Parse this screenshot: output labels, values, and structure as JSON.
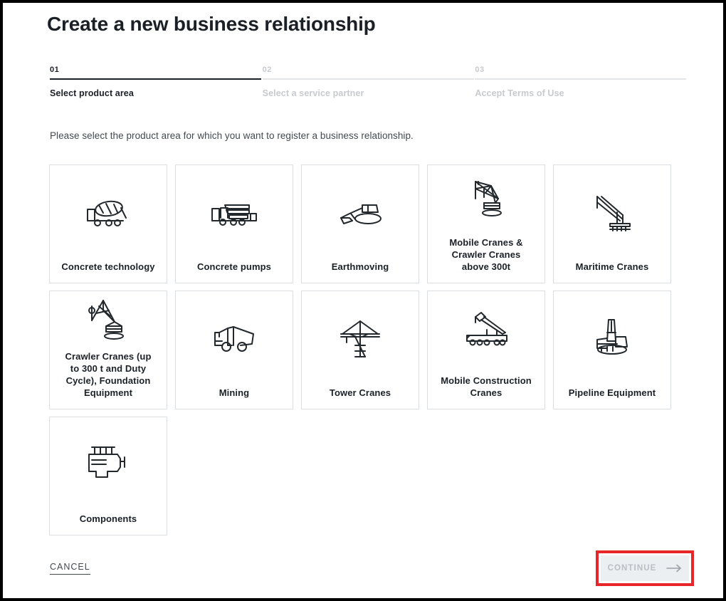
{
  "page": {
    "title": "Create a new business relationship",
    "intro": "Please select the product area for which you want to register a business relationship."
  },
  "stepper": {
    "steps": [
      {
        "number": "01",
        "label": "Select product area",
        "state": "active"
      },
      {
        "number": "02",
        "label": "Select a service partner",
        "state": "inactive"
      },
      {
        "number": "03",
        "label": "Accept Terms of Use",
        "state": "inactive"
      }
    ]
  },
  "product_areas": {
    "cards": [
      {
        "label": "Concrete technology",
        "icon": "concrete-mixer-truck-icon"
      },
      {
        "label": "Concrete pumps",
        "icon": "concrete-pump-truck-icon"
      },
      {
        "label": "Earthmoving",
        "icon": "excavator-icon"
      },
      {
        "label": "Mobile Cranes &\nCrawler Cranes\nabove 300t",
        "icon": "lattice-boom-crane-icon"
      },
      {
        "label": "Maritime Cranes",
        "icon": "maritime-crane-icon"
      },
      {
        "label": "Crawler Cranes (up\nto 300 t and Duty\nCycle), Foundation\nEquipment",
        "icon": "crawler-crane-icon"
      },
      {
        "label": "Mining",
        "icon": "dump-truck-icon"
      },
      {
        "label": "Tower Cranes",
        "icon": "tower-crane-icon"
      },
      {
        "label": "Mobile Construction\nCranes",
        "icon": "mobile-construction-crane-icon"
      },
      {
        "label": "Pipeline Equipment",
        "icon": "pipelayer-icon"
      },
      {
        "label": "Components",
        "icon": "engine-icon"
      }
    ]
  },
  "footer": {
    "cancel_label": "CANCEL",
    "continue_label": "CONTINUE",
    "continue_arrow_icon": "arrow-right-icon",
    "continue_disabled": true,
    "highlight_color": "#e8262a"
  },
  "colors": {
    "text_primary": "#1b2027",
    "text_muted": "#c7cace",
    "card_border": "#dcdfe2",
    "button_disabled_bg": "#eceff1",
    "button_disabled_text": "#b9bfc5",
    "highlight_red": "#e8262a",
    "page_border": "#000000"
  }
}
